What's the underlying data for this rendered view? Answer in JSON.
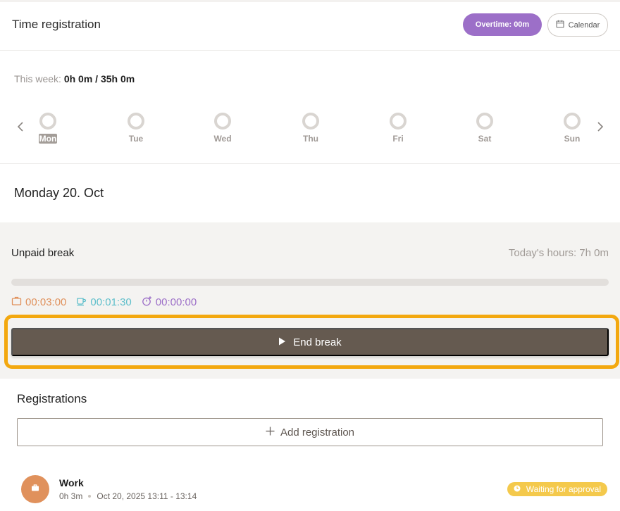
{
  "header": {
    "title": "Time registration",
    "overtime_label": "Overtime: 00m",
    "calendar_label": "Calendar"
  },
  "week": {
    "summary_label": "This week:",
    "summary_value": "0h 0m / 35h 0m",
    "days": [
      {
        "label": "Mon",
        "active": true
      },
      {
        "label": "Tue",
        "active": false
      },
      {
        "label": "Wed",
        "active": false
      },
      {
        "label": "Thu",
        "active": false
      },
      {
        "label": "Fri",
        "active": false
      },
      {
        "label": "Sat",
        "active": false
      },
      {
        "label": "Sun",
        "active": false
      }
    ]
  },
  "day_heading": "Monday 20. Oct",
  "break_panel": {
    "title": "Unpaid break",
    "todays_hours": "Today's hours: 7h 0m",
    "progress": 0,
    "work_time": "00:03:00",
    "break_time": "00:01:30",
    "overtime_time": "00:00:00",
    "end_break_label": "End break"
  },
  "registrations": {
    "title": "Registrations",
    "add_label": "Add registration",
    "items": [
      {
        "title": "Work",
        "duration": "0h 3m",
        "time_range": "Oct 20, 2025 13:11 - 13:14",
        "status": "Waiting for approval"
      }
    ]
  },
  "colors": {
    "accent_purple": "#9c6fc8",
    "work_orange": "#e0915c",
    "break_teal": "#5fbfcb",
    "button_brown": "#655a50",
    "highlight_orange": "#f3a80f",
    "status_yellow": "#f4c94c"
  },
  "icons": {
    "calendar": "calendar-icon",
    "prev": "chevron-left-icon",
    "next": "chevron-right-icon",
    "work_timer": "briefcase-icon",
    "break_timer": "coffee-cup-icon",
    "overtime_timer": "timer-plus-icon",
    "play": "play-icon",
    "add": "plus-icon",
    "status": "clock-icon"
  }
}
